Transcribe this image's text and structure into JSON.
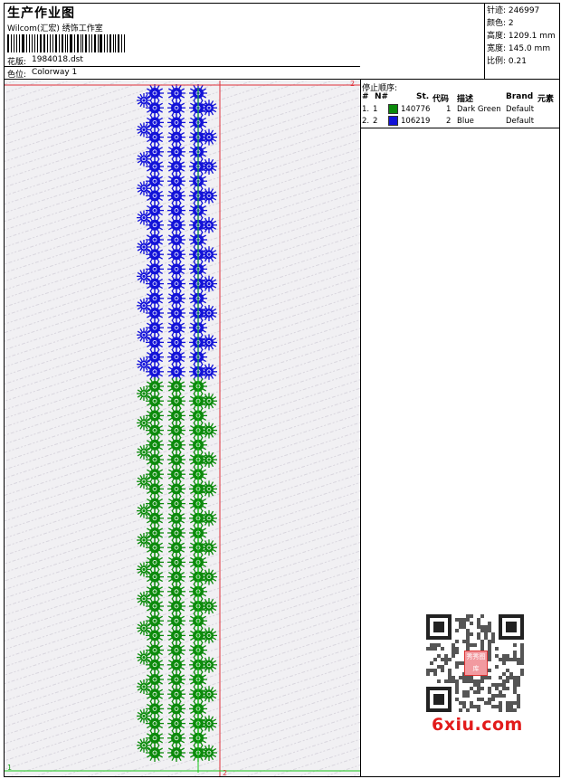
{
  "header": {
    "title": "生产作业图",
    "company": "Wilcom(汇宏) 绣饰工作室",
    "design_label": "花版:",
    "design_value": "1984018.dst",
    "colorway_label": "色位:",
    "colorway_value": "Colorway 1"
  },
  "stats": {
    "stitches_label": "针迹:",
    "stitches_value": "246997",
    "colors_label": "颜色:",
    "colors_value": "2",
    "height_label": "高度:",
    "height_value": "1209.1 mm",
    "width_label": "宽度:",
    "width_value": "145.0 mm",
    "scale_label": "比例:",
    "scale_value": "0.21"
  },
  "stop_sequence": {
    "title": "停止顺序:",
    "columns": [
      "#",
      "N#",
      "St.",
      "代码",
      "描述",
      "Brand",
      "元素"
    ],
    "rows": [
      {
        "num": "1.",
        "n": "1",
        "color": "#0b8a0b",
        "stitches": "140776",
        "code": "1",
        "desc": "Dark Green",
        "brand": "Default"
      },
      {
        "num": "2.",
        "n": "2",
        "color": "#1212d8",
        "stitches": "106219",
        "code": "2",
        "desc": "Blue",
        "brand": "Default"
      }
    ]
  },
  "canvas": {
    "marker_top_right": "2",
    "marker_bottom_left": "1",
    "marker_bottom_right": "2",
    "blue_stitches": 106219,
    "green_stitches": 140776
  },
  "watermark": {
    "text": "6xiu.com",
    "qr_label": "秀秀图库"
  },
  "colors": {
    "green": "#0b8a0b",
    "blue": "#1212d8",
    "red_line": "#e0303a",
    "green_line": "#18c818"
  }
}
